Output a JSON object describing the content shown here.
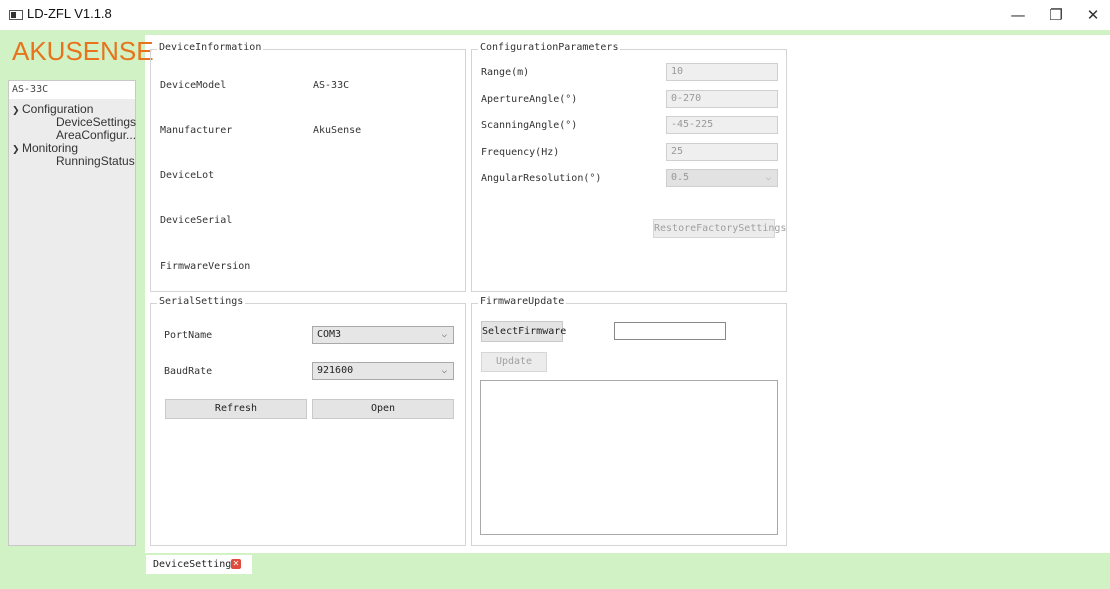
{
  "window": {
    "title": "LD-ZFL  V1.1.8",
    "minimize": "—",
    "restore": "❐",
    "close": "✕"
  },
  "brand": {
    "logo_text": "AKUSENSE",
    "color": "#e8731c"
  },
  "tree": {
    "root": "AS-33C",
    "groups": [
      {
        "label": "Configuration",
        "children": [
          "DeviceSettings",
          "AreaConfigur..."
        ]
      },
      {
        "label": "Monitoring",
        "children": [
          "RunningStatus"
        ]
      }
    ]
  },
  "device_info": {
    "title": "DeviceInformation",
    "rows": [
      {
        "label": "DeviceModel",
        "value": "AS-33C"
      },
      {
        "label": "Manufacturer",
        "value": "AkuSense"
      },
      {
        "label": "DeviceLot",
        "value": ""
      },
      {
        "label": "DeviceSerial",
        "value": ""
      },
      {
        "label": "FirmwareVersion",
        "value": ""
      }
    ]
  },
  "config": {
    "title": "ConfigurationParameters",
    "rows": [
      {
        "label": "Range(m)",
        "value": "10"
      },
      {
        "label": "ApertureAngle(°)",
        "value": "0-270"
      },
      {
        "label": "ScanningAngle(°)",
        "value": "-45-225"
      },
      {
        "label": "Frequency(Hz)",
        "value": "25"
      },
      {
        "label": "AngularResolution(°)",
        "value": "0.5"
      }
    ],
    "restore_button": "RestoreFactorySettings"
  },
  "serial": {
    "title": "SerialSettings",
    "port_label": "PortName",
    "port_value": "COM3",
    "baud_label": "BaudRate",
    "baud_value": "921600",
    "refresh_button": "Refresh",
    "open_button": "Open"
  },
  "firmware": {
    "title": "FirmwareUpdate",
    "select_button": "SelectFirmware",
    "path_value": "",
    "update_button": "Update",
    "log_text": ""
  },
  "tab": {
    "label": "DeviceSettings",
    "close": "✕"
  },
  "colors": {
    "frame": "#d1f2c4",
    "tab_close": "#e04a3a"
  }
}
